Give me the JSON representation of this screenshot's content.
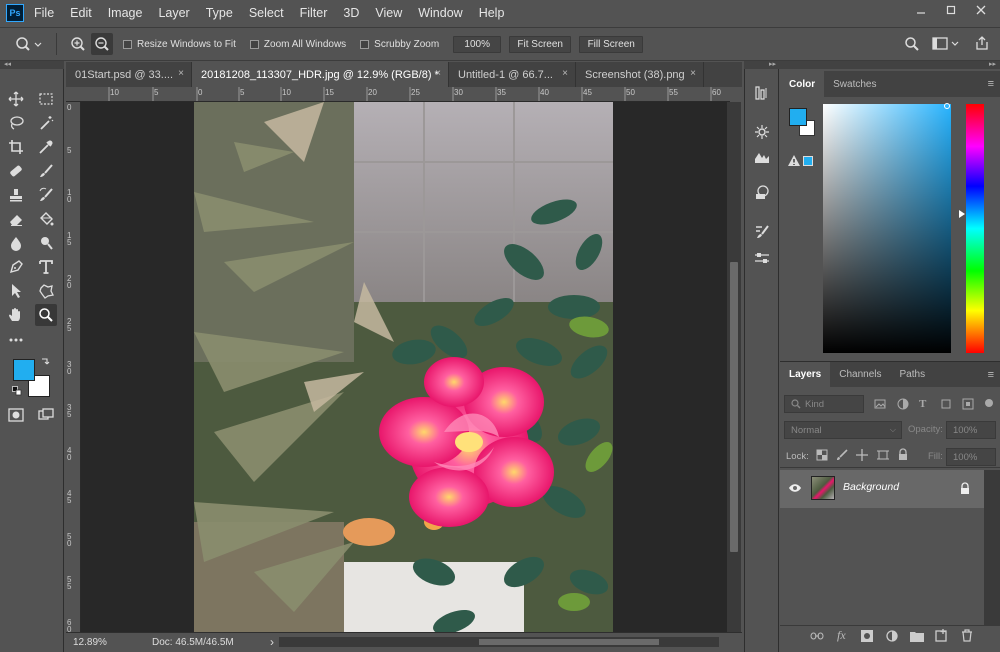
{
  "app": {
    "logo_text": "Ps"
  },
  "menu": [
    "File",
    "Edit",
    "Image",
    "Layer",
    "Type",
    "Select",
    "Filter",
    "3D",
    "View",
    "Window",
    "Help"
  ],
  "options_bar": {
    "resize_windows": "Resize Windows to Fit",
    "zoom_all_windows": "Zoom All Windows",
    "scrubby_zoom": "Scrubby Zoom",
    "zoom_percent": "100%",
    "fit_screen": "Fit Screen",
    "fill_screen": "Fill Screen"
  },
  "collapse_glyph": "◂◂",
  "tabs": [
    {
      "label": "01Start.psd @ 33....",
      "close": "×"
    },
    {
      "label": "20181208_113307_HDR.jpg @ 12.9% (RGB/8) *",
      "close": "×"
    },
    {
      "label": "Untitled-1 @ 66.7...",
      "close": "×"
    },
    {
      "label": "Screenshot (38).png",
      "close": "×"
    }
  ],
  "rulers": {
    "top": [
      "10",
      "5",
      "0",
      "5",
      "10",
      "15",
      "20",
      "25",
      "30",
      "35",
      "40",
      "45",
      "50",
      "55",
      "60"
    ],
    "left": [
      "0",
      "5",
      "1 0",
      "1 5",
      "2 0",
      "2 5",
      "3 0",
      "3 5",
      "4 0",
      "4 5",
      "5 0",
      "5 5",
      "6 0"
    ]
  },
  "status": {
    "zoom": "12.89%",
    "doc": "Doc: 46.5M/46.5M",
    "arrow": "›"
  },
  "color_panel": {
    "tabs": [
      "Color",
      "Swatches"
    ],
    "foreground": "#21aef0",
    "background": "#ffffff"
  },
  "layers_panel": {
    "tabs": [
      "Layers",
      "Channels",
      "Paths"
    ],
    "kind_label": "Kind",
    "blend_mode": "Normal",
    "opacity_label": "Opacity:",
    "opacity_value": "100%",
    "lock_label": "Lock:",
    "fill_label": "Fill:",
    "fill_value": "100%",
    "layers": [
      {
        "name": "Background"
      }
    ]
  },
  "colors": {
    "accent": "#31a8ff",
    "foreground_swatch": "#21aef0",
    "flower_pink": "#ee2a7b"
  }
}
